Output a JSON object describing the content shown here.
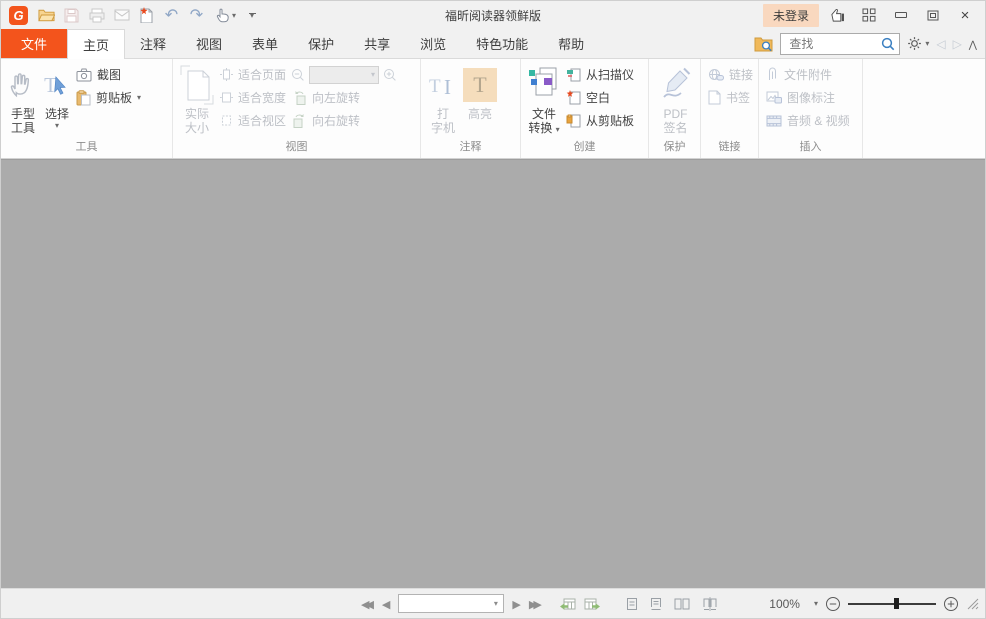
{
  "titlebar": {
    "title": "福昕阅读器领鲜版",
    "login_label": "未登录"
  },
  "tabbar": {
    "file_tab": "文件",
    "tabs": [
      "主页",
      "注释",
      "视图",
      "表单",
      "保护",
      "共享",
      "浏览",
      "特色功能",
      "帮助"
    ],
    "search_placeholder": "查找"
  },
  "ribbon": {
    "tools": {
      "label": "工具",
      "hand_line1": "手型",
      "hand_line2": "工具",
      "select": "选择",
      "snapshot": "截图",
      "clipboard": "剪贴板"
    },
    "view": {
      "label": "视图",
      "actual_line1": "实际",
      "actual_line2": "大小",
      "fit_page": "适合页面",
      "fit_width": "适合宽度",
      "fit_visible": "适合视区",
      "rotate_left": "向左旋转",
      "rotate_right": "向右旋转",
      "zoom_box_value": ""
    },
    "comment": {
      "label": "注释",
      "typewriter_line1": "打",
      "typewriter_line2": "字机",
      "highlight": "高亮"
    },
    "create": {
      "label": "创建",
      "convert_line1": "文件",
      "convert_line2": "转换",
      "from_scanner": "从扫描仪",
      "blank": "空白",
      "from_clipboard": "从剪贴板"
    },
    "protect": {
      "label": "保护",
      "sign_line1": "PDF",
      "sign_line2": "签名"
    },
    "link": {
      "label": "链接",
      "link": "链接",
      "bookmark": "书签"
    },
    "insert": {
      "label": "插入",
      "attachment": "文件附件",
      "image_annotation": "图像标注",
      "audio_video": "音频 & 视频"
    }
  },
  "statusbar": {
    "page_value": "",
    "zoom_value": "100%"
  },
  "colors": {
    "accent": "#f3541c",
    "login_badge_bg": "#f9d8bf",
    "document_area": "#ababab",
    "search_icon_blue": "#3a7fc1"
  }
}
